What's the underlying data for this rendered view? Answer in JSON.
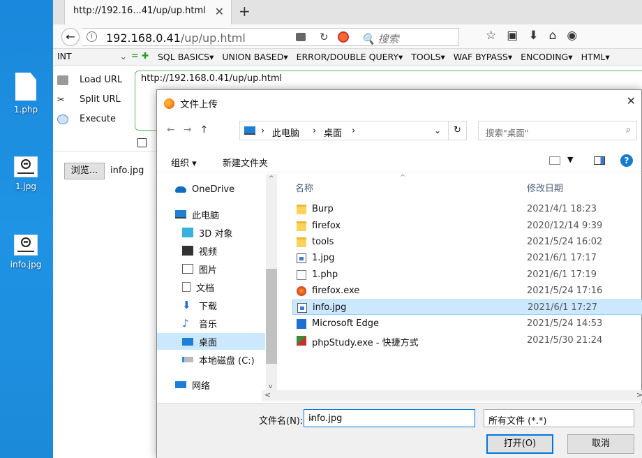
{
  "desktop": {
    "icons": [
      {
        "label": "1.php",
        "icon": "php-file-icon"
      },
      {
        "label": "1.jpg",
        "icon": "image-thumbnail-icon"
      },
      {
        "label": "info.jpg",
        "icon": "image-thumbnail-icon"
      }
    ]
  },
  "browser": {
    "tab_title": "http://192.16...41/up/up.html",
    "url_host": "192.168.0.41",
    "url_path": "/up/up.html",
    "search_placeholder": "搜索",
    "hackbar": {
      "select_value": "INT",
      "menus": [
        "SQL BASICS▾",
        "UNION BASED▾",
        "ERROR/DOUBLE QUERY▾",
        "TOOLS▾",
        "WAF BYPASS▾",
        "ENCODING▾",
        "HTML▾"
      ],
      "load_url": "Load URL",
      "split_url": "Split URL",
      "execute": "Execute",
      "url_text": "http://192.168.0.41/up/up.html"
    },
    "browse_label": "浏览...",
    "browse_file": "info.jpg"
  },
  "dialog": {
    "title": "文件上传",
    "breadcrumb": [
      "此电脑",
      "桌面"
    ],
    "search_placeholder": "搜索\"桌面\"",
    "organize": "组织 ▾",
    "new_folder": "新建文件夹",
    "nav_items": [
      {
        "label": "OneDrive",
        "icon": "onedrive-icon"
      },
      {
        "label": "此电脑",
        "icon": "this-pc-icon"
      },
      {
        "label": "3D 对象",
        "icon": "3d-objects-icon"
      },
      {
        "label": "视频",
        "icon": "video-icon"
      },
      {
        "label": "图片",
        "icon": "pictures-icon"
      },
      {
        "label": "文档",
        "icon": "documents-icon"
      },
      {
        "label": "下载",
        "icon": "download-icon"
      },
      {
        "label": "音乐",
        "icon": "music-icon"
      },
      {
        "label": "桌面",
        "icon": "desktop-icon",
        "selected": true
      },
      {
        "label": "本地磁盘 (C:)",
        "icon": "local-disk-icon"
      },
      {
        "label": "网络",
        "icon": "network-icon"
      }
    ],
    "columns": {
      "name": "名称",
      "modified": "修改日期"
    },
    "files": [
      {
        "name": "Burp",
        "date": "2021/4/1 18:23",
        "type": "folder"
      },
      {
        "name": "firefox",
        "date": "2020/12/14 9:39",
        "type": "folder"
      },
      {
        "name": "tools",
        "date": "2021/5/24 16:02",
        "type": "folder"
      },
      {
        "name": "1.jpg",
        "date": "2021/6/1 17:17",
        "type": "image"
      },
      {
        "name": "1.php",
        "date": "2021/6/1 17:19",
        "type": "file"
      },
      {
        "name": "firefox.exe",
        "date": "2021/5/24 17:16",
        "type": "exe"
      },
      {
        "name": "info.jpg",
        "date": "2021/6/1 17:27",
        "type": "image",
        "selected": true
      },
      {
        "name": "Microsoft Edge",
        "date": "2021/5/24 14:53",
        "type": "edge"
      },
      {
        "name": "phpStudy.exe - 快捷方式",
        "date": "2021/5/30 21:24",
        "type": "shortcut"
      }
    ],
    "filename_label": "文件名(N):",
    "filename_value": "info.jpg",
    "filetype_value": "所有文件 (*.*)",
    "open_button": "打开(O)",
    "cancel_button": "取消"
  }
}
